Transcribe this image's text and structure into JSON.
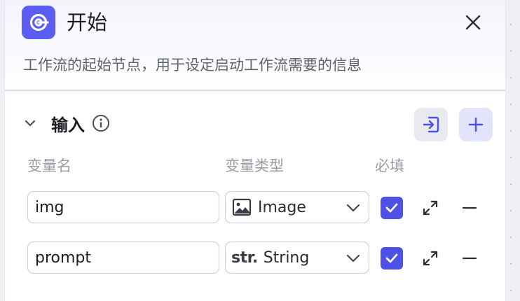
{
  "node": {
    "title": "开始",
    "description": "工作流的起始节点，用于设定启动工作流需要的信息",
    "icon": "start-node-icon",
    "accent_color": "#5b5ef0"
  },
  "input_section": {
    "title": "输入",
    "info_icon": "info-icon",
    "import_icon": "import-icon",
    "add_icon": "plus-icon",
    "columns": {
      "name": "变量名",
      "type": "变量类型",
      "required": "必填"
    },
    "variables": [
      {
        "name": "img",
        "type_glyph": "",
        "type_label": "Image",
        "type_icon": "image-icon",
        "required": true
      },
      {
        "name": "prompt",
        "type_glyph": "str.",
        "type_label": "String",
        "type_icon": "string-icon",
        "required": true
      }
    ]
  },
  "colors": {
    "checkbox": "#4d51e6",
    "add_button_bg": "#e3e4fb"
  }
}
